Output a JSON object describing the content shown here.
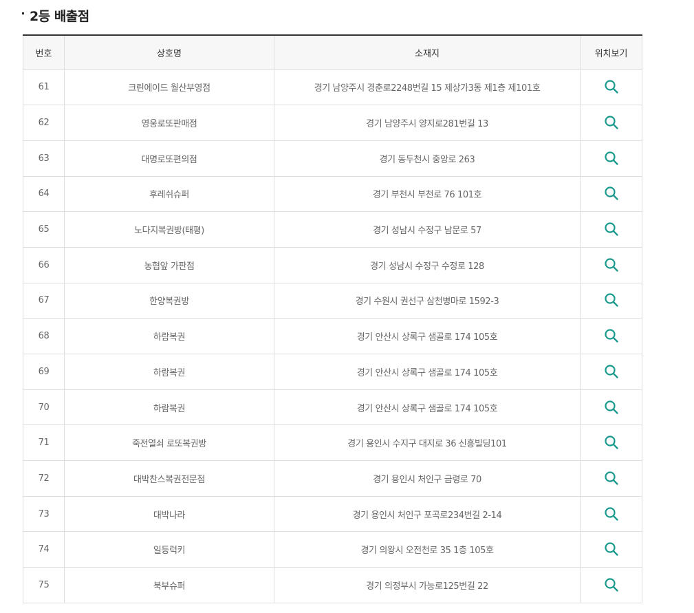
{
  "section": {
    "title": "2등 배출점"
  },
  "table": {
    "headers": {
      "num": "번호",
      "name": "상호명",
      "address": "소재지",
      "location": "위치보기"
    },
    "rows": [
      {
        "num": "61",
        "name": "크린에이드 월산부영점",
        "address": "경기 남양주시 경춘로2248번길 15 제상가3동 제1층 제101호"
      },
      {
        "num": "62",
        "name": "영웅로또판매점",
        "address": "경기 남양주시 양지로281번길 13"
      },
      {
        "num": "63",
        "name": "대명로또편의점",
        "address": "경기 동두천시 중앙로 263"
      },
      {
        "num": "64",
        "name": "후레쉬슈퍼",
        "address": "경기 부천시 부천로 76 101호"
      },
      {
        "num": "65",
        "name": "노다지복권방(태평)",
        "address": "경기 성남시 수정구 남문로 57"
      },
      {
        "num": "66",
        "name": "농협앞 가판점",
        "address": "경기 성남시 수정구 수정로 128"
      },
      {
        "num": "67",
        "name": "한양복권방",
        "address": "경기 수원시 권선구 삼천병마로 1592-3"
      },
      {
        "num": "68",
        "name": "하람복권",
        "address": "경기 안산시 상록구 샘골로 174 105호"
      },
      {
        "num": "69",
        "name": "하람복권",
        "address": "경기 안산시 상록구 샘골로 174 105호"
      },
      {
        "num": "70",
        "name": "하람복권",
        "address": "경기 안산시 상록구 샘골로 174 105호"
      },
      {
        "num": "71",
        "name": "죽전열쇠 로또복권방",
        "address": "경기 용인시 수지구 대지로 36 신흥빌딩101"
      },
      {
        "num": "72",
        "name": "대박찬스복권전문점",
        "address": "경기 용인시 처인구 금령로 70"
      },
      {
        "num": "73",
        "name": "대박나라",
        "address": "경기 용인시 처인구 포곡로234번길 2-14"
      },
      {
        "num": "74",
        "name": "일등럭키",
        "address": "경기 의왕시 오전천로 35 1층 105호"
      },
      {
        "num": "75",
        "name": "북부슈퍼",
        "address": "경기 의정부시 가능로125번길 22"
      }
    ]
  },
  "icons": {
    "location": "search-icon",
    "accent_color": "#1a9a8c"
  }
}
